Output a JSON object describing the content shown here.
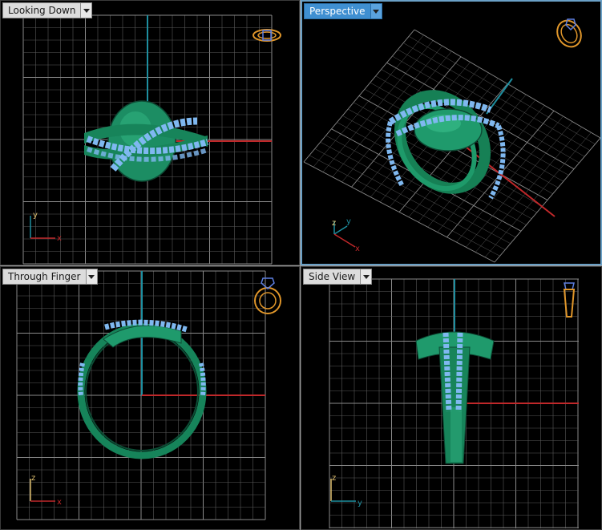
{
  "viewports": {
    "top_left": {
      "title": "Looking Down",
      "active": false,
      "axes": [
        "y",
        "x"
      ]
    },
    "top_right": {
      "title": "Perspective",
      "active": true,
      "axes": [
        "z",
        "y",
        "x"
      ]
    },
    "bottom_left": {
      "title": "Through Finger",
      "active": false,
      "axes": [
        "z",
        "x"
      ]
    },
    "bottom_right": {
      "title": "Side View",
      "active": false,
      "axes": [
        "z",
        "y"
      ]
    }
  },
  "colors": {
    "grid": "#5a5a5a",
    "grid_major": "#8a8a8a",
    "axis_x": "#c0282a",
    "axis_y": "#1e8fa0",
    "ring_metal": "#1f9a6c",
    "gem": "#7fb8f0",
    "widget_orange": "#e0962a",
    "widget_blue": "#5d7fe0",
    "active_border": "#6aa0c6",
    "background": "#000000"
  },
  "icons": [
    "view-cube-ring-widget-icon",
    "dropdown-arrow-icon"
  ]
}
